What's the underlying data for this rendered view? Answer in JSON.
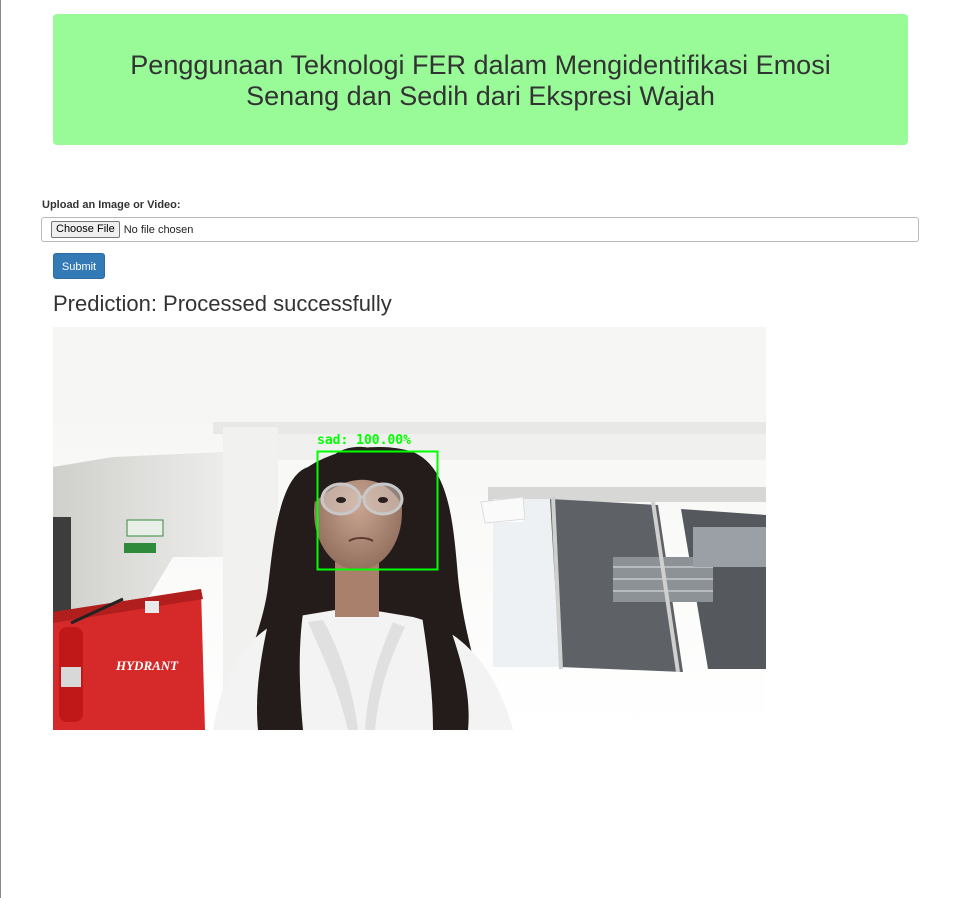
{
  "header": {
    "title": "Penggunaan Teknologi FER dalam Mengidentifikasi Emosi Senang dan Sedih dari Ekspresi Wajah"
  },
  "form": {
    "upload_label": "Upload an Image or Video:",
    "choose_file_label": "Choose File",
    "file_status": "No file chosen",
    "submit_label": "Submit"
  },
  "result": {
    "prediction_text": "Prediction: Processed successfully",
    "face_label": "sad: 100.00%",
    "scene_sign_text": "HYDRANT",
    "box_color": "#00ff00"
  },
  "colors": {
    "banner_bg": "#98fb98",
    "submit_bg": "#337ab7"
  }
}
